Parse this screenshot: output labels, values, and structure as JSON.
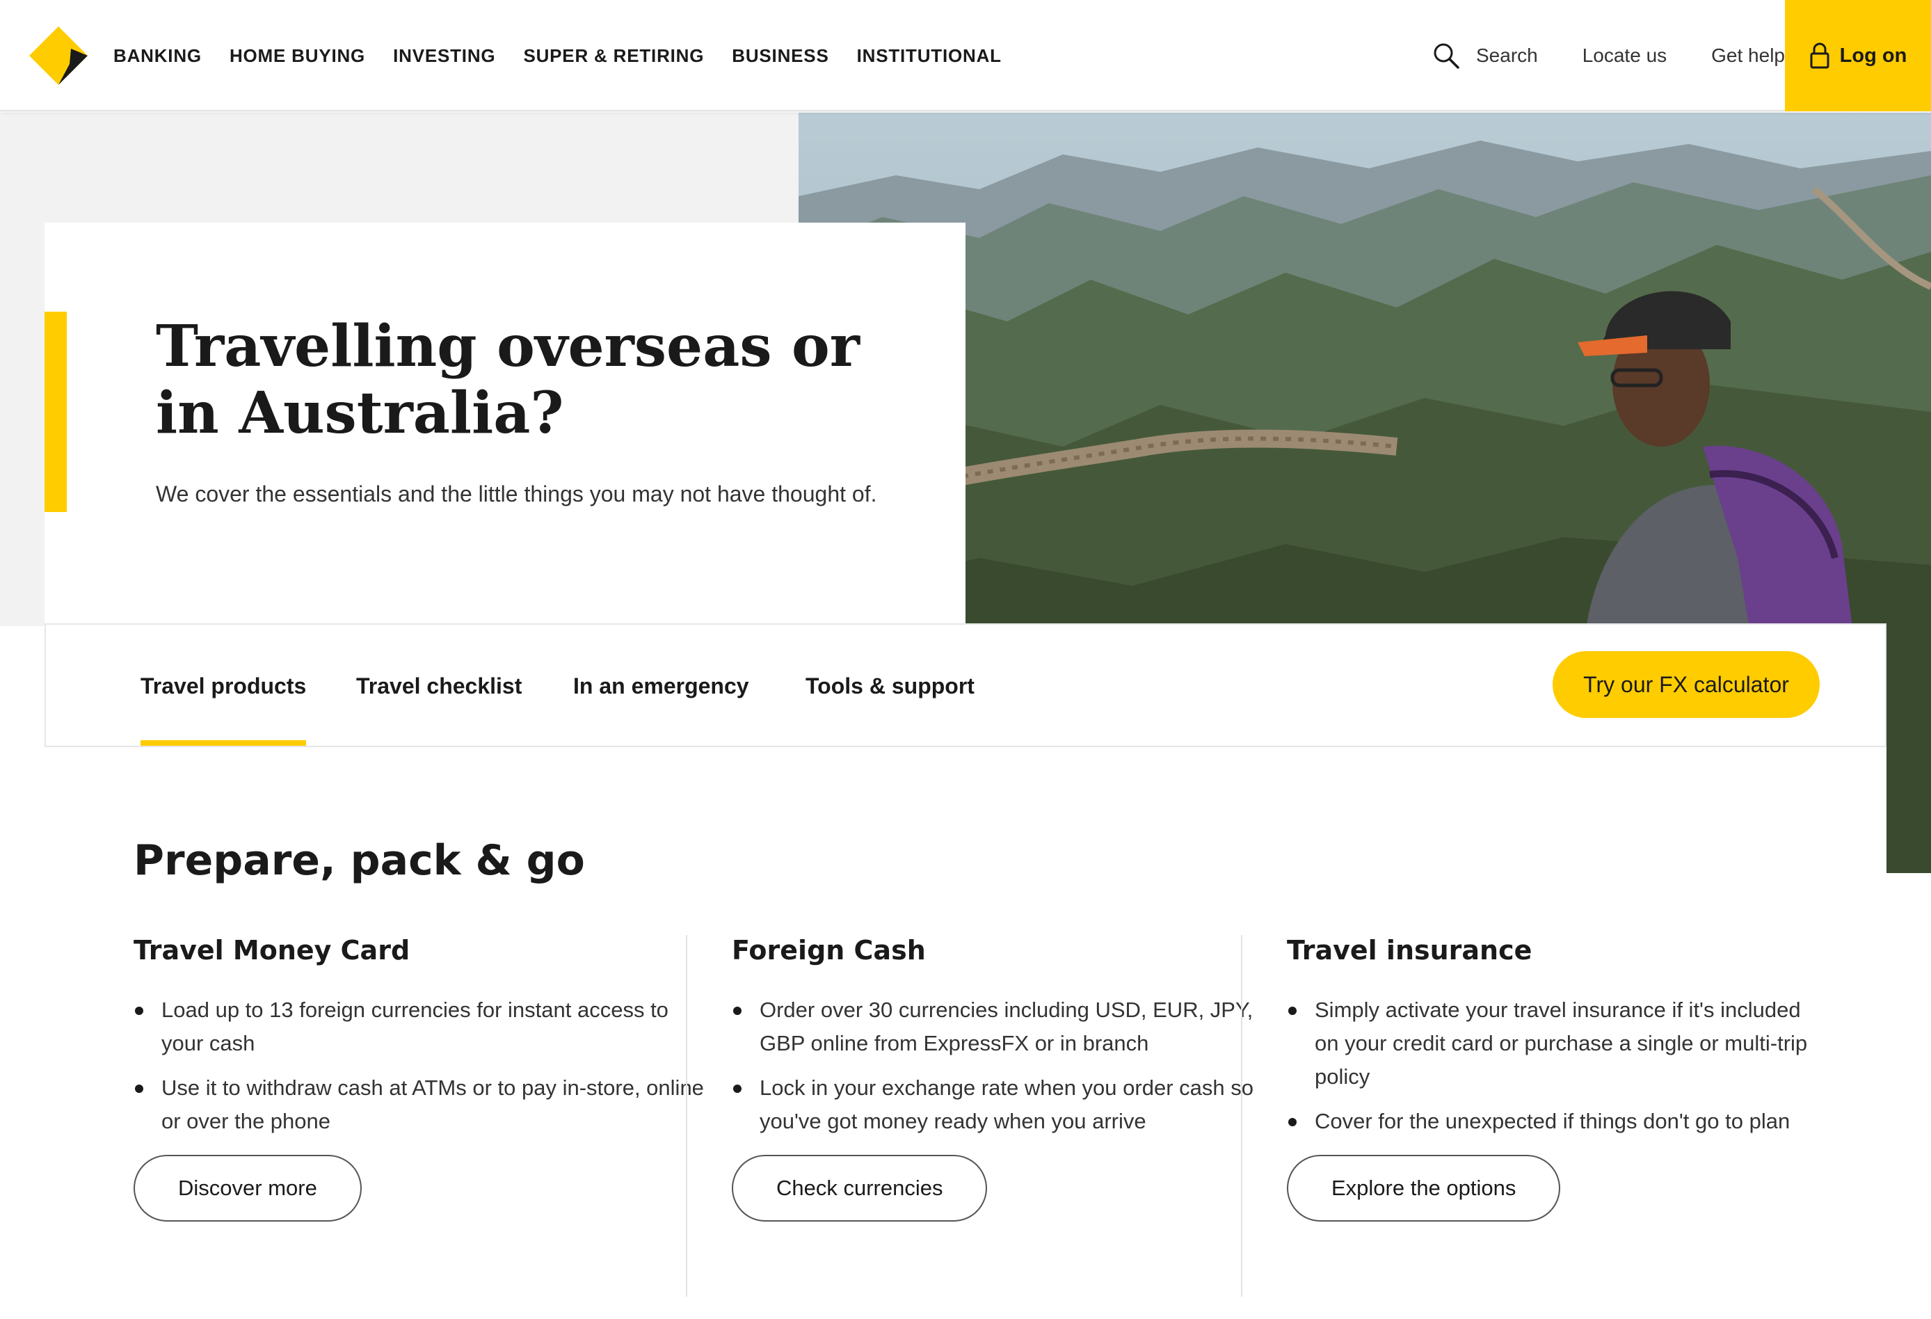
{
  "brand": {
    "accent": "#ffcc00",
    "logo": "commbank-diamond-logo"
  },
  "header": {
    "nav": [
      "BANKING",
      "HOME BUYING",
      "INVESTING",
      "SUPER & RETIRING",
      "BUSINESS",
      "INSTITUTIONAL"
    ],
    "search": "Search",
    "locate": "Locate us",
    "help": "Get help",
    "logon": "Log on"
  },
  "hero": {
    "title": "Travelling overseas or in Australia?",
    "subtitle": "We cover the essentials and the little things you may not have thought of."
  },
  "tabs": {
    "items": [
      "Travel products",
      "Travel checklist",
      "In an emergency",
      "Tools & support"
    ],
    "active": "Travel products",
    "cta": "Try our FX calculator"
  },
  "section": {
    "title": "Prepare, pack & go",
    "columns": [
      {
        "title": "Travel Money Card",
        "bullets": [
          "Load up to 13 foreign currencies for instant access to your cash",
          "Use it to withdraw cash at ATMs or to pay in-store, online or over the phone"
        ],
        "button": "Discover more"
      },
      {
        "title": "Foreign Cash",
        "bullets": [
          "Order over 30 currencies including USD, EUR, JPY, GBP online from ExpressFX or in branch",
          "Lock in your exchange rate when you order cash so you've got money ready when you arrive"
        ],
        "button": "Check currencies"
      },
      {
        "title": "Travel insurance",
        "bullets": [
          "Simply activate your travel insurance if it's included on your credit card or purchase a single or multi-trip policy",
          "Cover for the unexpected if things don't go to plan"
        ],
        "button": "Explore the options"
      }
    ]
  }
}
